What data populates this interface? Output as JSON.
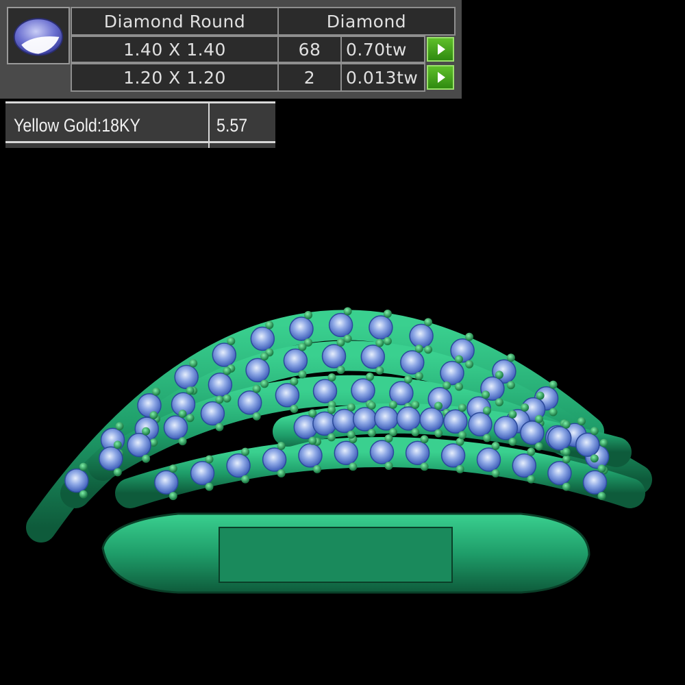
{
  "stone_panel": {
    "thumbnail_icon": "round-diamond-gem-icon",
    "header": {
      "shape": "Diamond Round",
      "type": "Diamond"
    },
    "rows": [
      {
        "size": "1.40 X 1.40",
        "count": "68",
        "weight": "0.70tw",
        "action_icon": "play-arrow-icon"
      },
      {
        "size": "1.20 X 1.20",
        "count": "2",
        "weight": "0.013tw",
        "action_icon": "play-arrow-icon"
      }
    ]
  },
  "metal_panel": {
    "metal": "Yellow Gold:18KY",
    "weight": "5.57"
  },
  "render": {
    "metal_color": "#1f9e6a",
    "stone_color": "#6f8fd6",
    "background": "#000000"
  }
}
